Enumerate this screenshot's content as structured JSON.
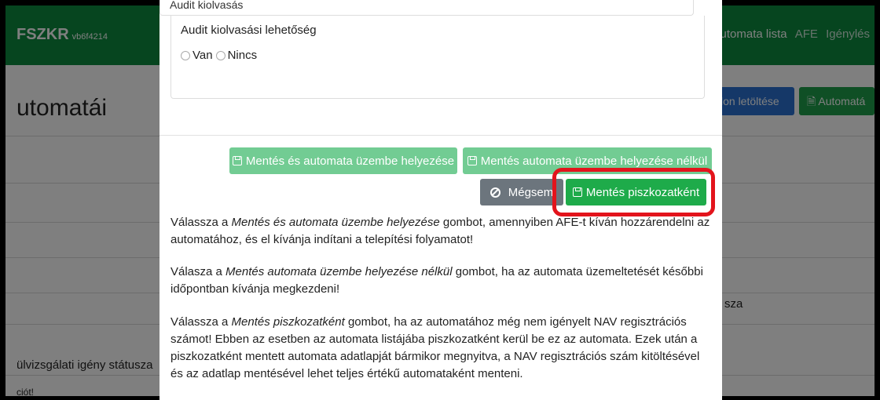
{
  "navbar": {
    "brand": "FSZKR",
    "version": "vb6f4214",
    "links": [
      "utomata lista",
      "AFE",
      "Igénylés"
    ]
  },
  "page": {
    "title": "utomatái",
    "btn_download": "lon letöltése",
    "btn_automata": "Automatá",
    "row_text_right": "sza",
    "row_text_left": "ülvizsgálati igény státusza",
    "row_text_bottom": "ciót!"
  },
  "modal": {
    "top_input_value": "Audit kiolvasás",
    "audit_label": "Audit kiolvasási lehetőség",
    "radio_options": [
      "Van",
      "Nincs"
    ],
    "buttons": {
      "save_and_deploy": "Mentés és automata üzembe helyezése",
      "save_without_deploy": "Mentés automata üzembe helyezése nélkül",
      "cancel": "Mégsem",
      "save_draft": "Mentés piszkozatként"
    },
    "help": {
      "p1_pre": "Válassza a ",
      "p1_em": "Mentés és automata üzembe helyezése",
      "p1_post": " gombot, amennyiben AFE-t kíván hozzárendelni az automatához, és el kívánja indítani a telepítési folyamatot!",
      "p2_pre": "Válasza a ",
      "p2_em": "Mentés automata üzembe helyezése nélkül",
      "p2_post": " gombot, ha az automata üzemeltetését későbbi időpontban kívánja megkezdeni!",
      "p3_pre": "Válassza a ",
      "p3_em": "Mentés piszkozatként",
      "p3_post": " gombot, ha az automatához még nem igényelt NAV regisztrációs számot! Ebben az esetben az automata listájába piszkozatként kerül be ez az automata. Ezek után a piszkozatként mentett automata adatlapját bármikor megnyitva, a NAV regisztrációs szám kitöltésével és az adatlap mentésével lehet teljes értékű automataként menteni."
    }
  },
  "colors": {
    "navbar": "#0c8a3f",
    "highlight": "#e3141c",
    "primary_green": "#1eab4a",
    "light_green": "#72cc93"
  }
}
